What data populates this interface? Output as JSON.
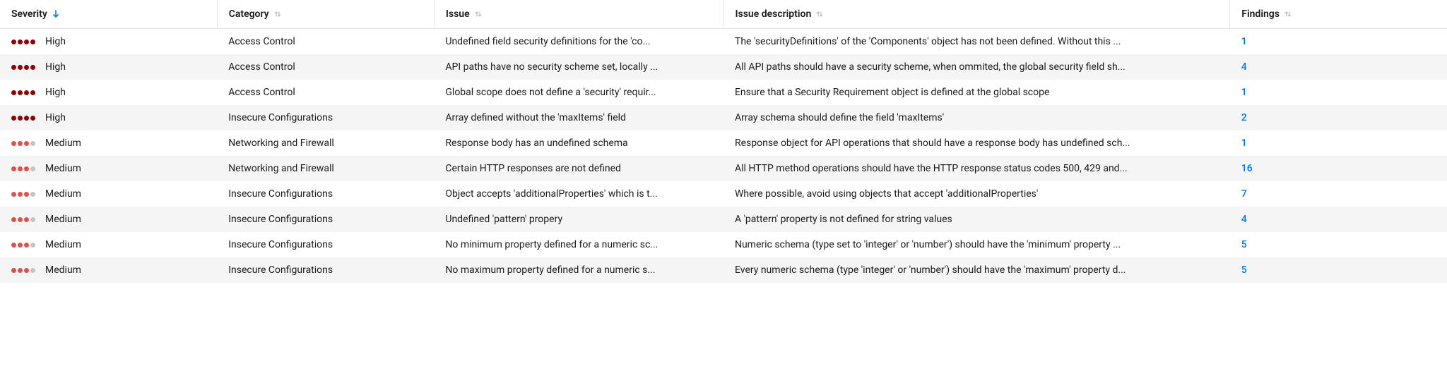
{
  "columns": {
    "severity": "Severity",
    "category": "Category",
    "issue": "Issue",
    "description": "Issue description",
    "findings": "Findings"
  },
  "sort": {
    "column": "severity",
    "direction": "asc"
  },
  "rows": [
    {
      "severity": "High",
      "category": "Access Control",
      "issue": "Undefined field security definitions for the 'co...",
      "description": "The 'securityDefinitions' of the 'Components' object has not been defined. Without this ...",
      "findings": "1"
    },
    {
      "severity": "High",
      "category": "Access Control",
      "issue": "API paths have no security scheme set, locally ...",
      "description": "All API paths should have a security scheme, when ommited, the global security field sh...",
      "findings": "4"
    },
    {
      "severity": "High",
      "category": "Access Control",
      "issue": "Global scope does not define a 'security' requir...",
      "description": "Ensure that a Security Requirement object is defined at the global scope",
      "findings": "1"
    },
    {
      "severity": "High",
      "category": "Insecure Configurations",
      "issue": "Array defined without the 'maxItems' field",
      "description": "Array schema should define the field 'maxItems'",
      "findings": "2"
    },
    {
      "severity": "Medium",
      "category": "Networking and Firewall",
      "issue": "Response body has an undefined schema",
      "description": "Response object for API operations that should have a response body has undefined sch...",
      "findings": "1"
    },
    {
      "severity": "Medium",
      "category": "Networking and Firewall",
      "issue": "Certain HTTP responses are not defined",
      "description": "All HTTP method operations should have the HTTP response status codes 500, 429 and...",
      "findings": "16"
    },
    {
      "severity": "Medium",
      "category": "Insecure Configurations",
      "issue": "Object accepts 'additionalProperties' which is t...",
      "description": "Where possible, avoid using objects that accept 'additionalProperties'",
      "findings": "7"
    },
    {
      "severity": "Medium",
      "category": "Insecure Configurations",
      "issue": "Undefined 'pattern' propery",
      "description": "A 'pattern' property is not defined for string values",
      "findings": "4"
    },
    {
      "severity": "Medium",
      "category": "Insecure Configurations",
      "issue": "No minimum property defined for a numeric sc...",
      "description": "Numeric schema (type set to 'integer' or 'number') should have the 'minimum' property ...",
      "findings": "5"
    },
    {
      "severity": "Medium",
      "category": "Insecure Configurations",
      "issue": "No maximum property defined for a numeric s...",
      "description": "Every numeric schema (type 'integer' or 'number') should have the 'maximum' property d...",
      "findings": "5"
    }
  ]
}
